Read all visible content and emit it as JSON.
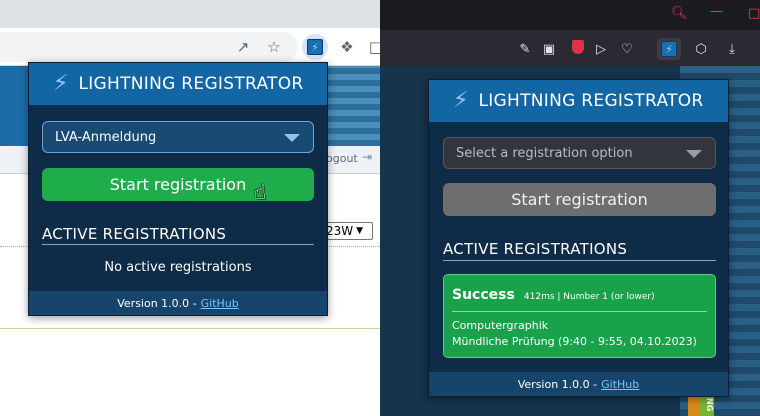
{
  "left_popup": {
    "title": "LIGHTNING REGISTRATOR",
    "select_value": "LVA-Anmeldung",
    "start_label": "Start registration",
    "section_title": "ACTIVE REGISTRATIONS",
    "empty_text": "No active registrations",
    "version_text": "Version 1.0.0 - ",
    "github_label": "GitHub"
  },
  "right_popup": {
    "title": "LIGHTNING REGISTRATOR",
    "select_placeholder": "Select a registration option",
    "start_label": "Start registration",
    "section_title": "ACTIVE REGISTRATIONS",
    "registration": {
      "status": "Success",
      "meta": "412ms | Number 1 (or lower)",
      "course": "Computergraphik",
      "detail": "Mündliche Prüfung (9:40 - 9:55, 04.10.2023)"
    },
    "version_text": "Version 1.0.0 - ",
    "github_label": "GitHub"
  },
  "background_page": {
    "logout_label": "ogout",
    "semester_value": "23W"
  },
  "colors": {
    "popup_bg": "#0e2c47",
    "header_bg": "#1366a4",
    "start_active": "#1fad4c",
    "start_disabled": "#6e6e6e",
    "success_bg": "#19a24a"
  }
}
